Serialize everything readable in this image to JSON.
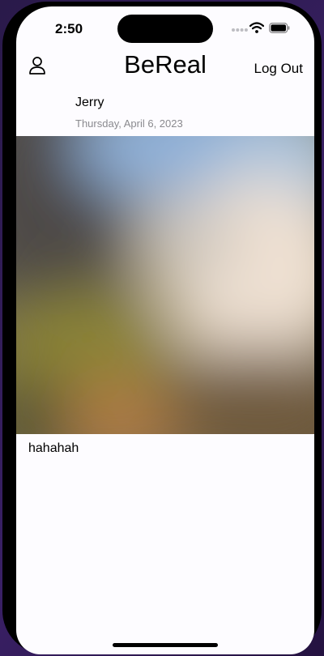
{
  "status_bar": {
    "time": "2:50",
    "icons": [
      "cellular-signal-icon",
      "wifi-icon",
      "battery-icon"
    ]
  },
  "nav": {
    "title": "BeReal",
    "logout_label": "Log Out",
    "profile_icon": "person-icon"
  },
  "post": {
    "username": "Jerry",
    "date": "Thursday, April 6, 2023",
    "caption": "hahahah"
  },
  "colors": {
    "background": "#fdfcff",
    "text": "#000000",
    "secondary_text": "#8a8a8e"
  }
}
